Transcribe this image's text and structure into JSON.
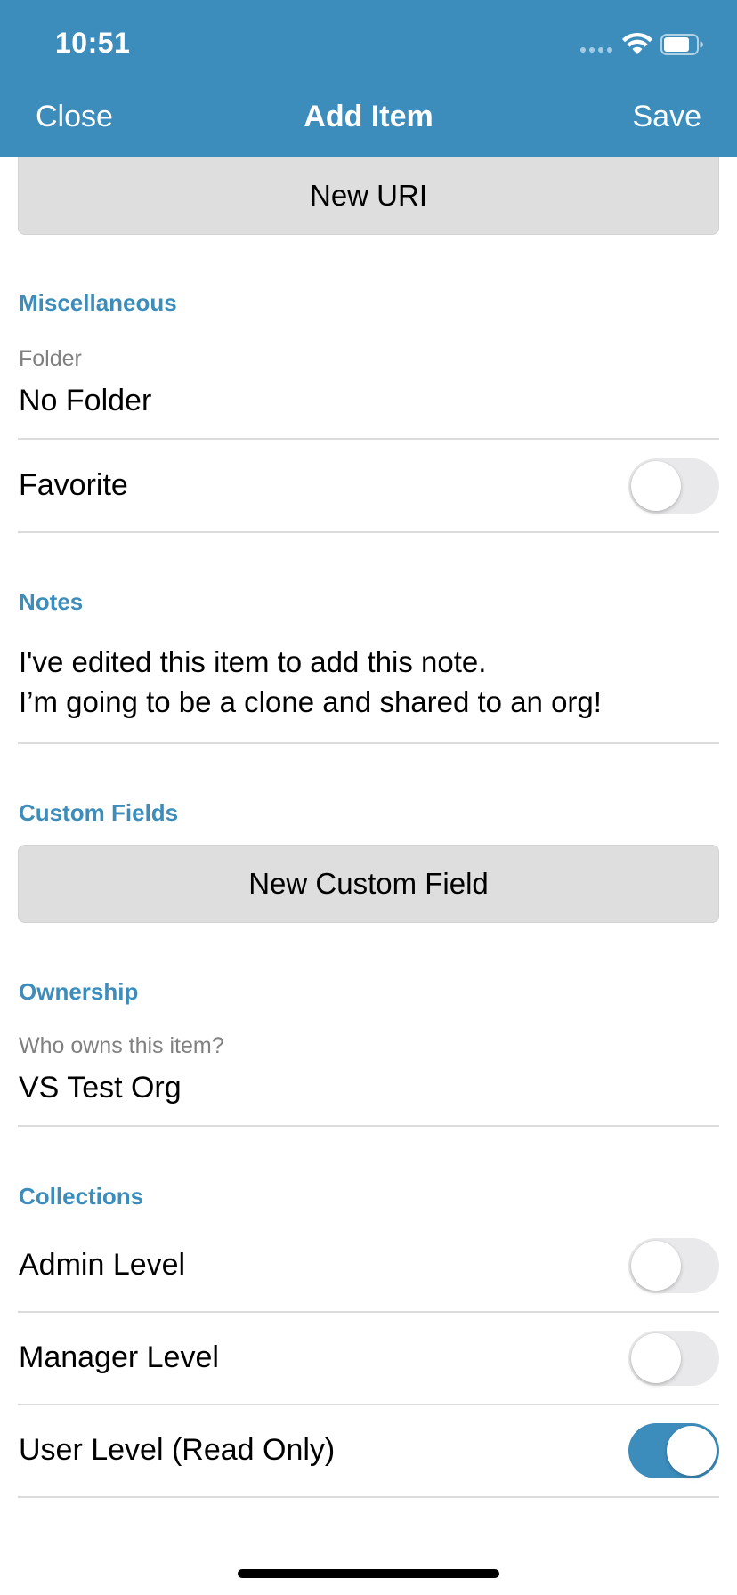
{
  "status_bar": {
    "time": "10:51"
  },
  "nav": {
    "close_label": "Close",
    "title": "Add Item",
    "save_label": "Save"
  },
  "uris": {
    "new_uri_label": "New URI"
  },
  "miscellaneous": {
    "title": "Miscellaneous",
    "folder_label": "Folder",
    "folder_value": "No Folder",
    "favorite_label": "Favorite",
    "favorite_on": false
  },
  "notes": {
    "title": "Notes",
    "line1": "I've edited this item to add this note.",
    "line2": "I’m going to be a clone and shared to an org!"
  },
  "custom_fields": {
    "title": "Custom Fields",
    "new_field_label": "New Custom Field"
  },
  "ownership": {
    "title": "Ownership",
    "owner_label": "Who owns this item?",
    "owner_value": "VS Test Org"
  },
  "collections": {
    "title": "Collections",
    "items": [
      {
        "label": "Admin Level",
        "on": false
      },
      {
        "label": "Manager Level",
        "on": false
      },
      {
        "label": "User Level (Read Only)",
        "on": true
      }
    ]
  },
  "colors": {
    "accent": "#3c8dbc",
    "button_bg": "#dedede",
    "toggle_off": "#e9e9eb"
  }
}
